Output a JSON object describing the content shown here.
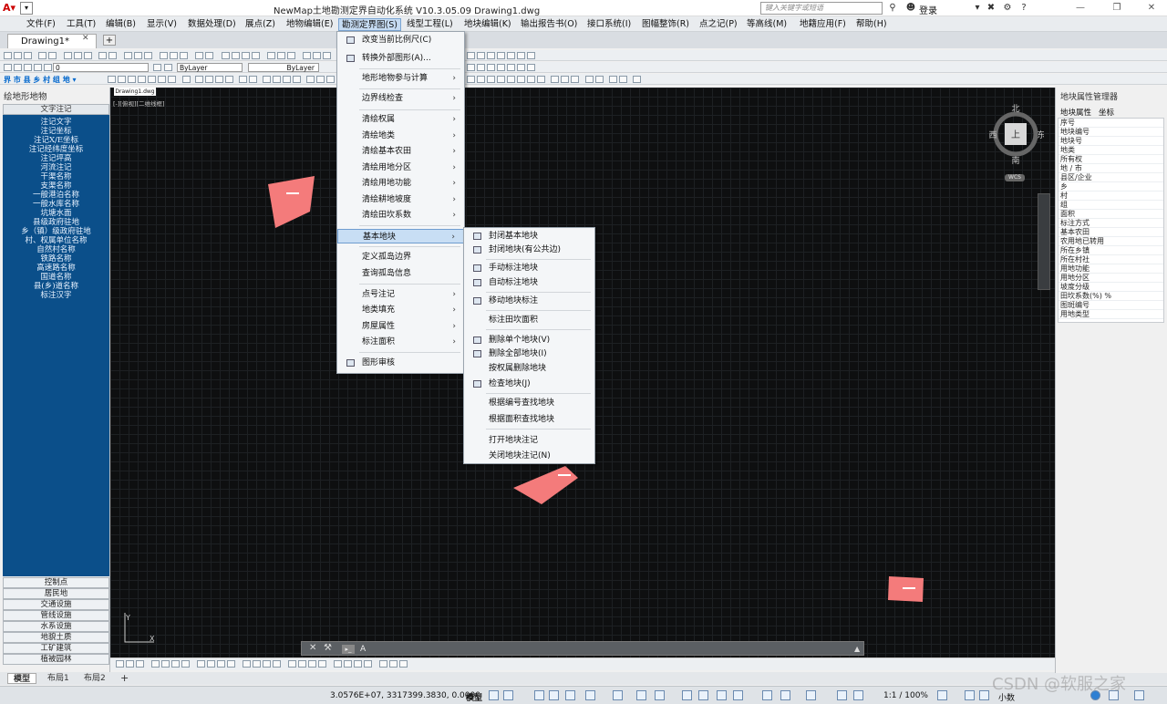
{
  "title": "NewMap土地勘测定界自动化系统 V10.3.05.09    Drawing1.dwg",
  "search_placeholder": "键入关键字或短语",
  "login": "登录",
  "menus": [
    "文件(F)",
    "工具(T)",
    "编辑(B)",
    "显示(V)",
    "数据处理(D)",
    "展点(Z)",
    "地物编辑(E)",
    "勘测定界图(S)",
    "线型工程(L)",
    "地块编辑(K)",
    "输出报告书(O)",
    "接口系统(I)",
    "图幅整饰(R)",
    "点之记(P)",
    "等高线(M)",
    "地籍应用(F)",
    "帮助(H)"
  ],
  "doc_tab": "Drawing1*",
  "canvas_tab": "Drawing1.dwg",
  "view_label": "[-][俯视][二维线框]",
  "layer_combo": "0",
  "bylayer1": "ByLayer",
  "bylayer2": "ByLayer",
  "left_panel": {
    "title": "绘地形地物",
    "section": "文字注记",
    "items": [
      "注记文字",
      "注记坐标",
      "注记X/E坐标",
      "注记经纬度坐标",
      "注记坪高",
      "河流注记",
      "干渠名称",
      "支渠名称",
      "一般港泊名称",
      "一般水库名称",
      "坑塘水面",
      "县级政府驻地",
      "乡（镇）级政府驻地",
      "村、权属单位名称",
      "自然村名称",
      "铁路名称",
      "高速路名称",
      "国道名称",
      "县(乡)道名称",
      "标注汉字"
    ],
    "categories": [
      "控制点",
      "居民地",
      "交通设施",
      "管线设施",
      "水系设施",
      "地貌土质",
      "工矿建筑",
      "植被园林"
    ]
  },
  "right_panel": {
    "title": "地块属性管理器",
    "tab1": "地块属性",
    "tab2": "坐标",
    "props": [
      "序号",
      "地块编号",
      "地块号",
      "地类",
      "所有权",
      "地 / 市",
      "县区/企业",
      "乡",
      "村",
      "组",
      "面积",
      "标注方式",
      "基本农田",
      "农用地已转用",
      "所在乡镇",
      "所在村社",
      "用地功能",
      "用地分区",
      "坡度分级",
      "田坎系数(%) %",
      "图斑编号",
      "用地类型"
    ]
  },
  "compass": {
    "north": "北",
    "south": "南",
    "east": "东",
    "west": "西",
    "center": "上",
    "wcs": "WCS"
  },
  "ucs": {
    "x": "X",
    "y": "Y"
  },
  "main_menu": {
    "items": [
      {
        "label": "改变当前比例尺(C)",
        "icon": true,
        "arrow": false
      },
      {
        "label": "转换外部图形(A)...",
        "icon": true,
        "arrow": false
      },
      {
        "label": "地形地物参与计算",
        "icon": false,
        "arrow": true
      },
      {
        "label": "边界线检查",
        "icon": false,
        "arrow": true
      },
      {
        "label": "清绘权属",
        "icon": false,
        "arrow": true
      },
      {
        "label": "清绘地类",
        "icon": false,
        "arrow": true
      },
      {
        "label": "清绘基本农田",
        "icon": false,
        "arrow": true
      },
      {
        "label": "清绘用地分区",
        "icon": false,
        "arrow": true
      },
      {
        "label": "清绘用地功能",
        "icon": false,
        "arrow": true
      },
      {
        "label": "清绘耕地坡度",
        "icon": false,
        "arrow": true
      },
      {
        "label": "清绘田坎系数",
        "icon": false,
        "arrow": true
      },
      {
        "label": "基本地块",
        "icon": false,
        "arrow": true,
        "highlight": true
      },
      {
        "label": "定义孤岛边界",
        "icon": false,
        "arrow": false
      },
      {
        "label": "查询孤岛信息",
        "icon": false,
        "arrow": false
      },
      {
        "label": "点号注记",
        "icon": false,
        "arrow": true
      },
      {
        "label": "地类填充",
        "icon": false,
        "arrow": true
      },
      {
        "label": "房屋属性",
        "icon": false,
        "arrow": true
      },
      {
        "label": "标注面积",
        "icon": false,
        "arrow": true
      },
      {
        "label": "图形审核",
        "icon": true,
        "arrow": false
      }
    ]
  },
  "sub_menu": {
    "items": [
      "封闭基本地块",
      "封闭地块(有公共边)",
      "手动标注地块",
      "自动标注地块",
      "移动地块标注",
      "标注田坎面积",
      "删除单个地块(V)",
      "删除全部地块(I)",
      "按权属删除地块",
      "检查地块(J)",
      "根据编号查找地块",
      "根据面积查找地块",
      "打开地块注记",
      "关闭地块注记(N)"
    ]
  },
  "command_prompt": "A",
  "layout_tabs": [
    "模型",
    "布局1",
    "布局2"
  ],
  "status": {
    "coords": "3.0576E+07, 3317399.3830, 0.0000",
    "model": "模型",
    "scale": "1:1 / 100%",
    "units": "小数"
  },
  "watermark": "CSDN @软服之家"
}
